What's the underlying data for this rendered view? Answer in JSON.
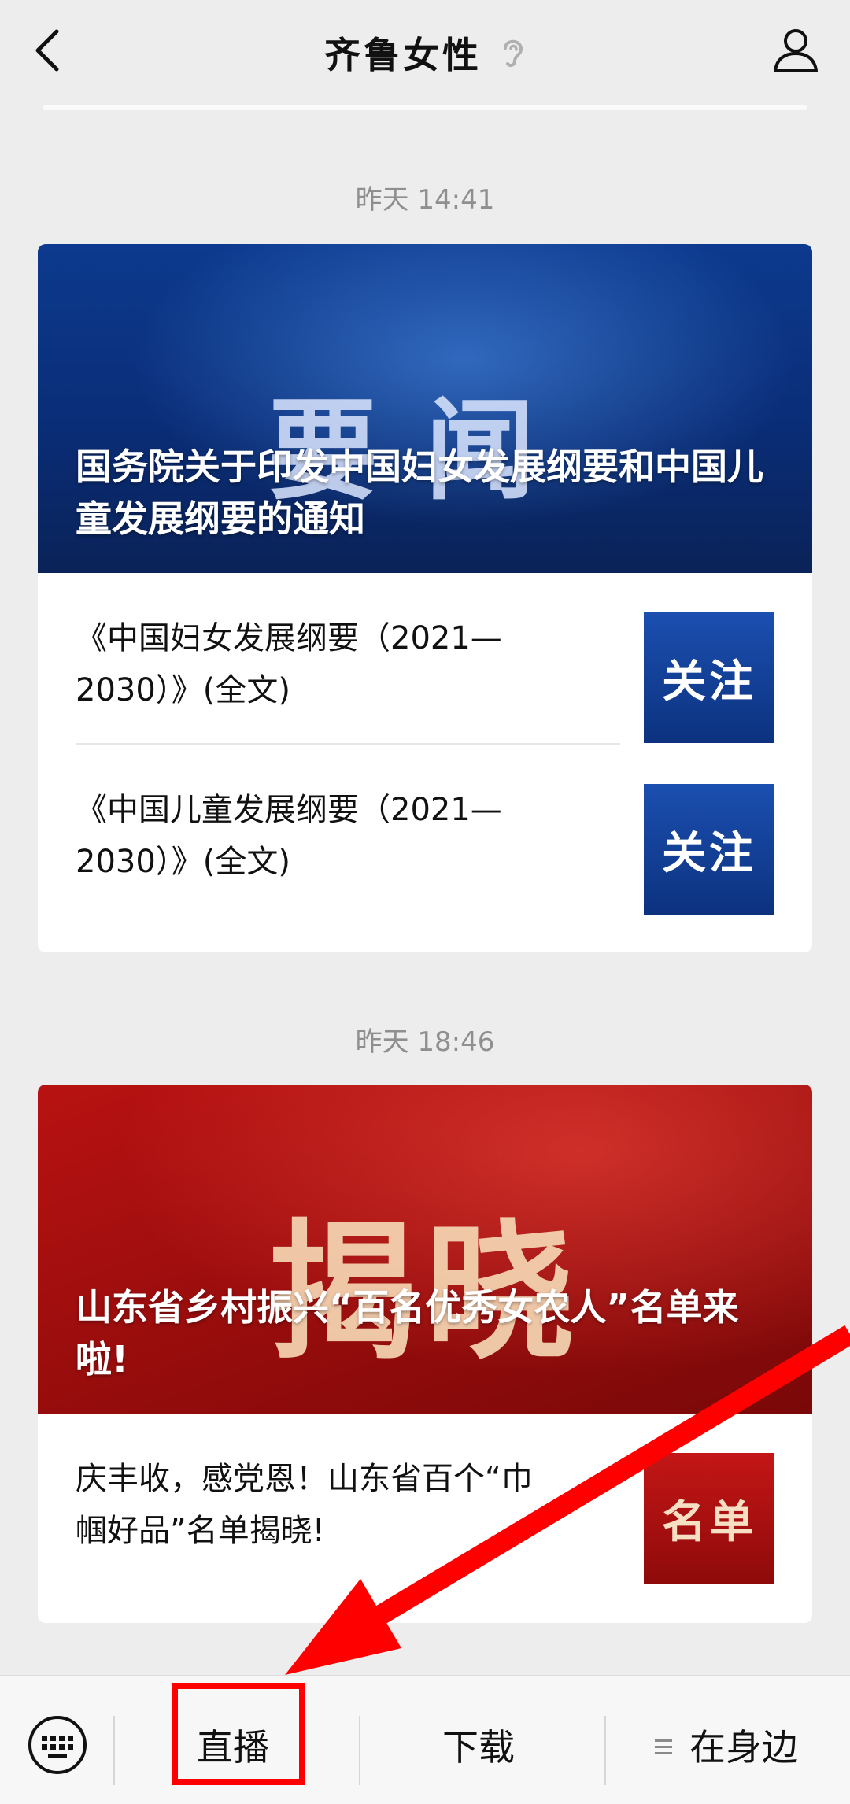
{
  "header": {
    "title": "齐鲁女性",
    "back_icon": "chevron-left-icon",
    "ear_icon": "ear-icon",
    "profile_icon": "user-icon"
  },
  "messages": [
    {
      "timestamp": "昨天 14:41",
      "cover": {
        "big_text": "要闻",
        "title": "国务院关于印发中国妇女发展纲要和中国儿童发展纲要的通知",
        "theme": "#0d3a8e"
      },
      "items": [
        {
          "text": "《中国妇女发展纲要（2021—2030）》(全文)",
          "thumb_text": "关注"
        },
        {
          "text": "《中国儿童发展纲要（2021—2030）》(全文)",
          "thumb_text": "关注"
        }
      ]
    },
    {
      "timestamp": "昨天 18:46",
      "cover": {
        "big_text": "揭晓",
        "title": "山东省乡村振兴“百名优秀女农人”名单来啦!",
        "theme": "#b81212"
      },
      "items": [
        {
          "text": "庆丰收，感党恩！山东省百个“巾帼好品”名单揭晓!",
          "thumb_text": "名单"
        }
      ]
    }
  ],
  "bottom_bar": {
    "keyboard_icon": "keyboard-icon",
    "menu": [
      "直播",
      "下载",
      "在身边"
    ],
    "menu_icon": "menu-lines-icon"
  },
  "annotation": {
    "color": "#ff0000"
  }
}
